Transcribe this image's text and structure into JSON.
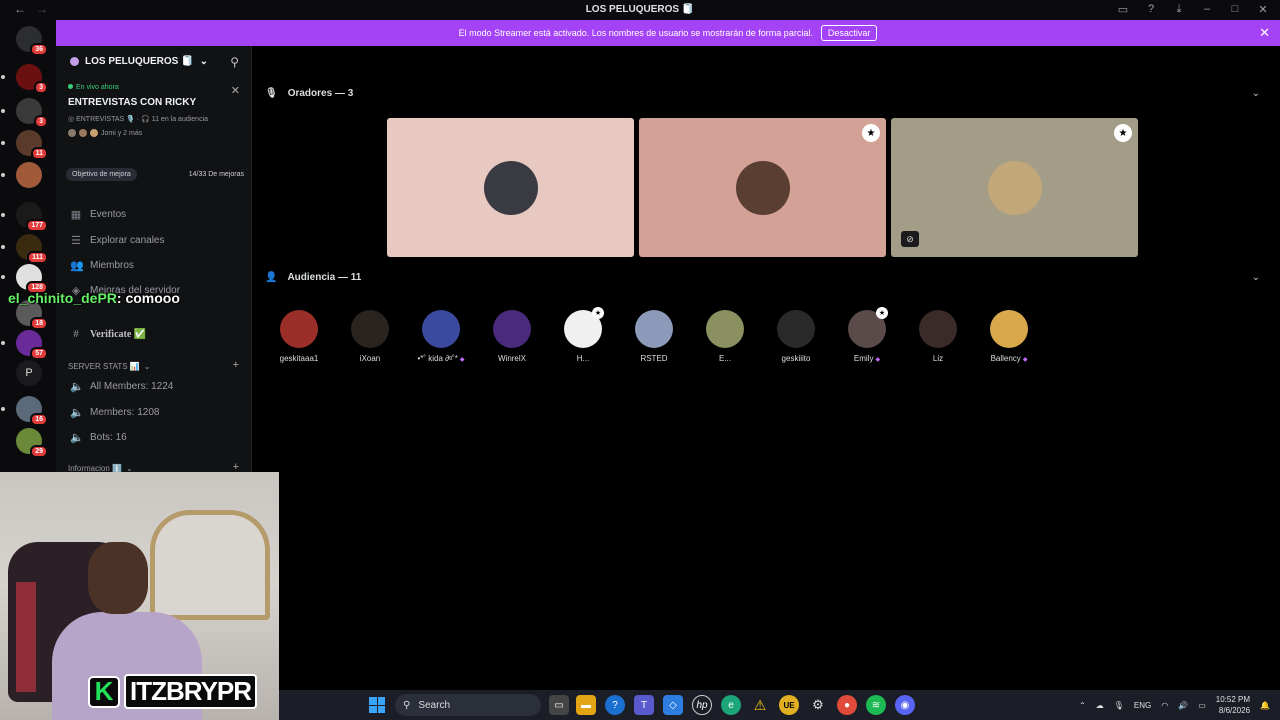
{
  "window": {
    "title": "LOS PELUQUEROS 🧻",
    "back": "←",
    "forward": "→"
  },
  "streamer_banner": {
    "text": "El modo Streamer está activado. Los nombres de usuario se mostrarán de forma parcial.",
    "button": "Desactivar",
    "close": "✕"
  },
  "server_list": {
    "badges": [
      "36",
      "3",
      "3",
      "11",
      "177",
      "111",
      "128",
      "18",
      "57",
      "16",
      "29"
    ],
    "letter_server": "P"
  },
  "server": {
    "name": "LOS PELUQUEROS 🧻",
    "live": {
      "tag": "En vivo ahora",
      "title": "ENTREVISTAS CON RICKY",
      "channel": "ENTREVISTAS 🎙️",
      "audience": "11 en la audiencia",
      "people": "Jomi y 2 más"
    },
    "boost": {
      "goal": "Objetivo de mejora",
      "progress": "14/33 De mejoras"
    },
    "nav": [
      {
        "label": "Eventos"
      },
      {
        "label": "Explorar canales"
      },
      {
        "label": "Miembros"
      },
      {
        "label": "Mejoras del servidor"
      }
    ],
    "verify_channel": "Verificate ✅",
    "stats_category": "SERVER STATS 📊",
    "stats": [
      "All Members: 1224",
      "Members: 1208",
      "Bots: 16"
    ],
    "info_category": "Informacion ℹ️"
  },
  "overlay_chat": {
    "user": "el_chinito_dePR",
    "message": ": comooo"
  },
  "stage": {
    "speakers_label": "Oradores — 3",
    "audience_label": "Audiencia — 11",
    "speakers": [
      {
        "bg": "#e7c9c1",
        "avatar": "#3a3a42"
      },
      {
        "bg": "#d4a197",
        "avatar": "#5a3e32"
      },
      {
        "bg": "#a39c86",
        "avatar": "#c2a878"
      }
    ],
    "audience": [
      {
        "name": "geskitaaa1",
        "color": "#9c2e2a"
      },
      {
        "name": "iXoan",
        "color": "#2a2420"
      },
      {
        "name": "•*˚ kida ∂ᵍ˚*",
        "color": "#3a4a9e",
        "boost": "◆"
      },
      {
        "name": "WinrelX",
        "color": "#4a2a7a"
      },
      {
        "name": "H...",
        "color": "#f0f0f0",
        "speaker": "★"
      },
      {
        "name": "RSTED",
        "color": "#8a9ab8"
      },
      {
        "name": "E...",
        "color": "#8a9060"
      },
      {
        "name": "geskiiito",
        "color": "#2a2a2a"
      },
      {
        "name": "Emily",
        "color": "#5a4a4a",
        "boost": "◆",
        "speaker": "★"
      },
      {
        "name": "Liz",
        "color": "#3a2a28"
      },
      {
        "name": "Ballency",
        "color": "#d8a84a",
        "boost": "◆"
      }
    ]
  },
  "webcam": {
    "channel_logo": "K",
    "channel_name": "ITZBRYPR"
  },
  "taskbar": {
    "search": "Search",
    "language": "ENG",
    "time": "10:52 PM",
    "date": "8/6/2026",
    "notif_badge": "51"
  }
}
